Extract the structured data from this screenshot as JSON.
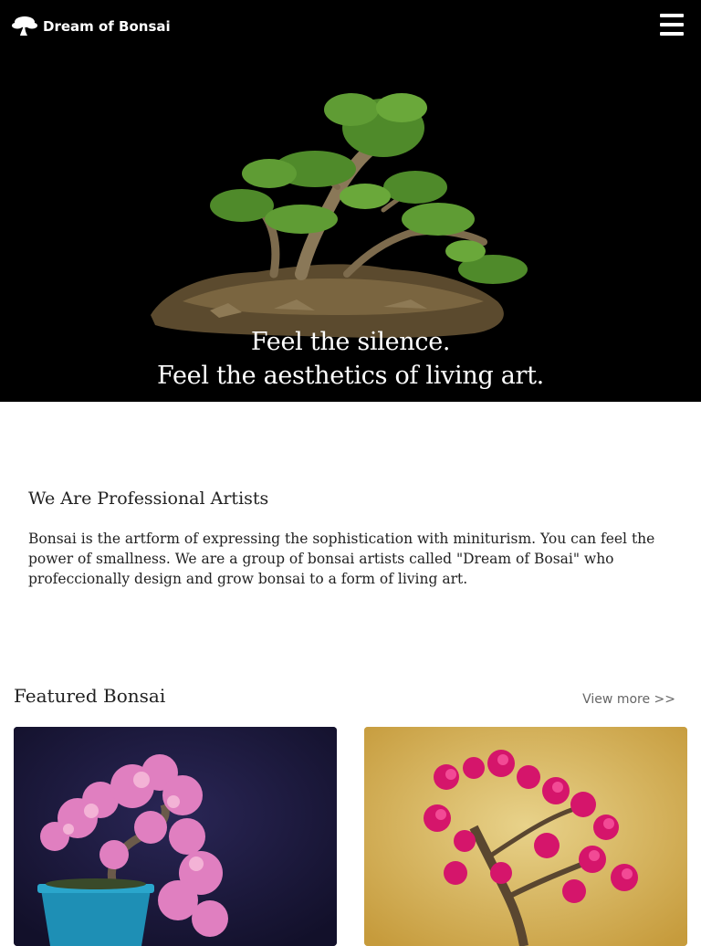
{
  "header": {
    "brand": "Dream of Bonsai",
    "logo_icon": "tree-icon",
    "menu_icon": "hamburger-menu-icon"
  },
  "hero": {
    "tagline_line1": "Feel the silence.",
    "tagline_line2": "Feel the aesthetics of living art."
  },
  "about": {
    "heading": "We Are Professional Artists",
    "body": "Bonsai is the artform of expressing the sophistication with miniturism. You can feel the power of smallness. We are a group of bonsai artists called \"Dream of Bosai\" who profeccionally design and grow bonsai to a form of living art."
  },
  "featured": {
    "title": "Featured Bonsai",
    "view_more": "View more >>"
  },
  "colors": {
    "hero_bg": "#000000",
    "card1_bg": "#1c1a3e",
    "card2_bg": "#d3b25b",
    "blossom_pink": "#e07fc0",
    "blossom_magenta": "#d5156b",
    "foliage_green": "#4f8a2a"
  }
}
